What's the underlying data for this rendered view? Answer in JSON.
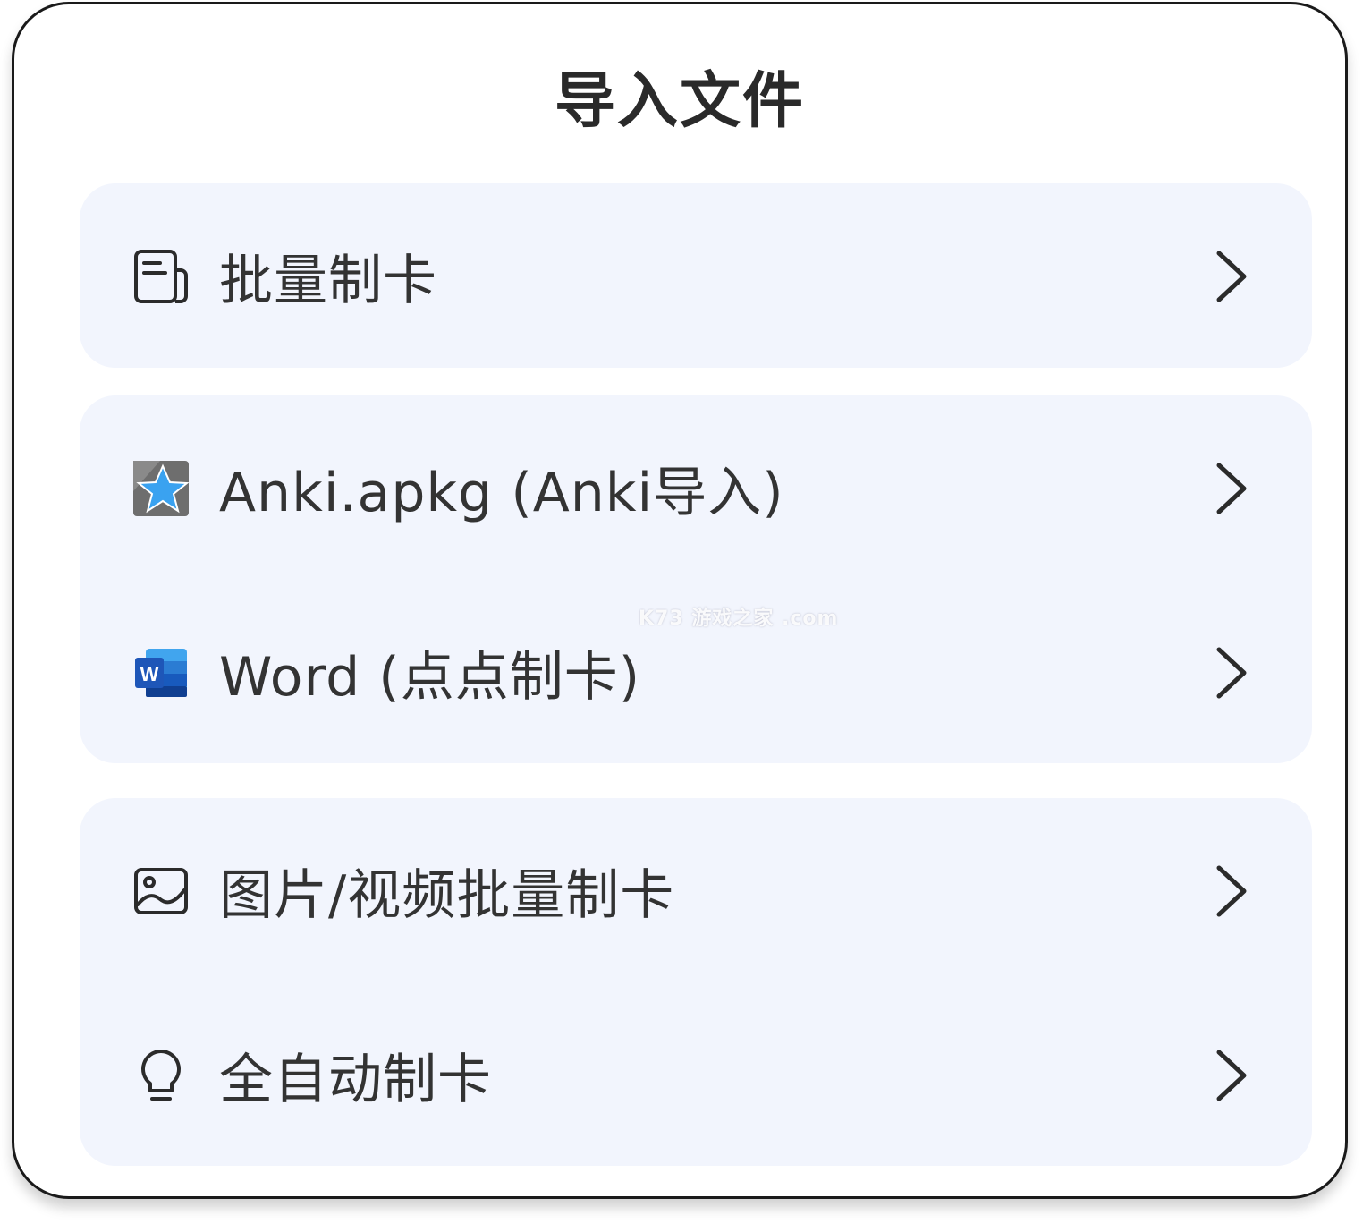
{
  "dialog": {
    "title": "导入文件"
  },
  "items": [
    {
      "label": "批量制卡",
      "icon": "batch-card-icon"
    },
    {
      "label": "Anki.apkg (Anki导入)",
      "icon": "anki-star-icon"
    },
    {
      "label": "Word (点点制卡)",
      "icon": "word-icon"
    },
    {
      "label": "图片/视频批量制卡",
      "icon": "image-icon"
    },
    {
      "label": "全自动制卡",
      "icon": "lightbulb-icon"
    }
  ],
  "watermark": "K73 游戏之家 .com",
  "colors": {
    "card_bg": "#f2f5fd",
    "text": "#333333",
    "word_blue": "#1e56b8",
    "anki_star": "#3aa2f0"
  }
}
